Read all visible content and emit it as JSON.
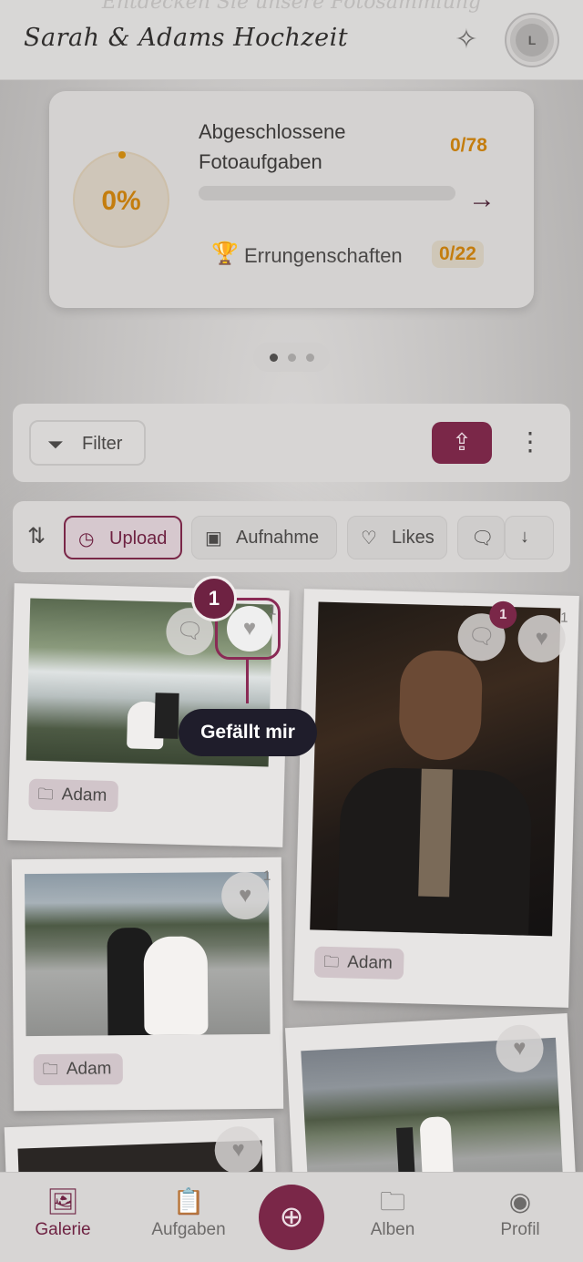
{
  "background_heading": "Entdecken Sie unsere Fotosammlung",
  "header": {
    "title": "Sarah & Adams Hochzeit",
    "sparkle_icon": "sparkles-icon",
    "avatar_initial": "L"
  },
  "progress_card": {
    "percent_label": "0%",
    "percent_value": 0,
    "tasks_label": "Abgeschlossene Fotoaufgaben",
    "tasks_count": "0/78",
    "achievements_label": "Errungenschaften",
    "achievements_count": "0/22"
  },
  "toolbar": {
    "filter_label": "Filter"
  },
  "sort": {
    "chips": [
      {
        "label": "Upload",
        "icon": "clock-icon",
        "active": true
      },
      {
        "label": "Aufnahme",
        "icon": "image-icon",
        "active": false
      },
      {
        "label": "Likes",
        "icon": "heart-icon",
        "active": false
      }
    ]
  },
  "photos": [
    {
      "album": "Adam",
      "comments": "",
      "likes": "1"
    },
    {
      "album": "Adam",
      "comment_badge": "1",
      "likes": "1"
    },
    {
      "album": "Adam",
      "likes": "1"
    },
    {
      "album": "",
      "likes": ""
    }
  ],
  "tutorial": {
    "step": "1",
    "tooltip": "Gefällt mir"
  },
  "nav": {
    "items": [
      {
        "label": "Galerie",
        "active": true
      },
      {
        "label": "Aufgaben",
        "active": false
      },
      {
        "label": "Alben",
        "active": false
      },
      {
        "label": "Profil",
        "active": false
      }
    ]
  },
  "colors": {
    "accent": "#7a2748",
    "gold": "#c47d0e",
    "tooltip_bg": "#1f1d2b"
  }
}
